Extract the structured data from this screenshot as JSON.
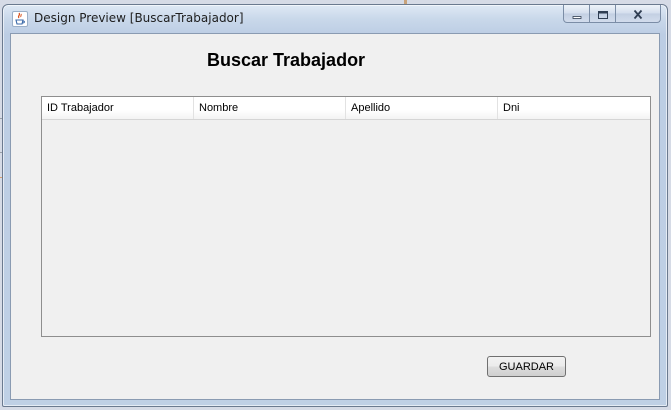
{
  "window": {
    "title": "Design Preview [BuscarTrabajador]",
    "app_icon": "java-cup-icon",
    "controls": {
      "minimize": "minimize-icon",
      "maximize": "maximize-icon",
      "close": "close-icon"
    }
  },
  "form": {
    "heading": "Buscar Trabajador",
    "table": {
      "columns": [
        "ID Trabajador",
        "Nombre",
        "Apellido",
        "Dni"
      ],
      "rows": []
    },
    "save_label": "GUARDAR"
  },
  "colors": {
    "client_background": "#f0f0f0",
    "frame_accent": "#bfd0e5"
  }
}
